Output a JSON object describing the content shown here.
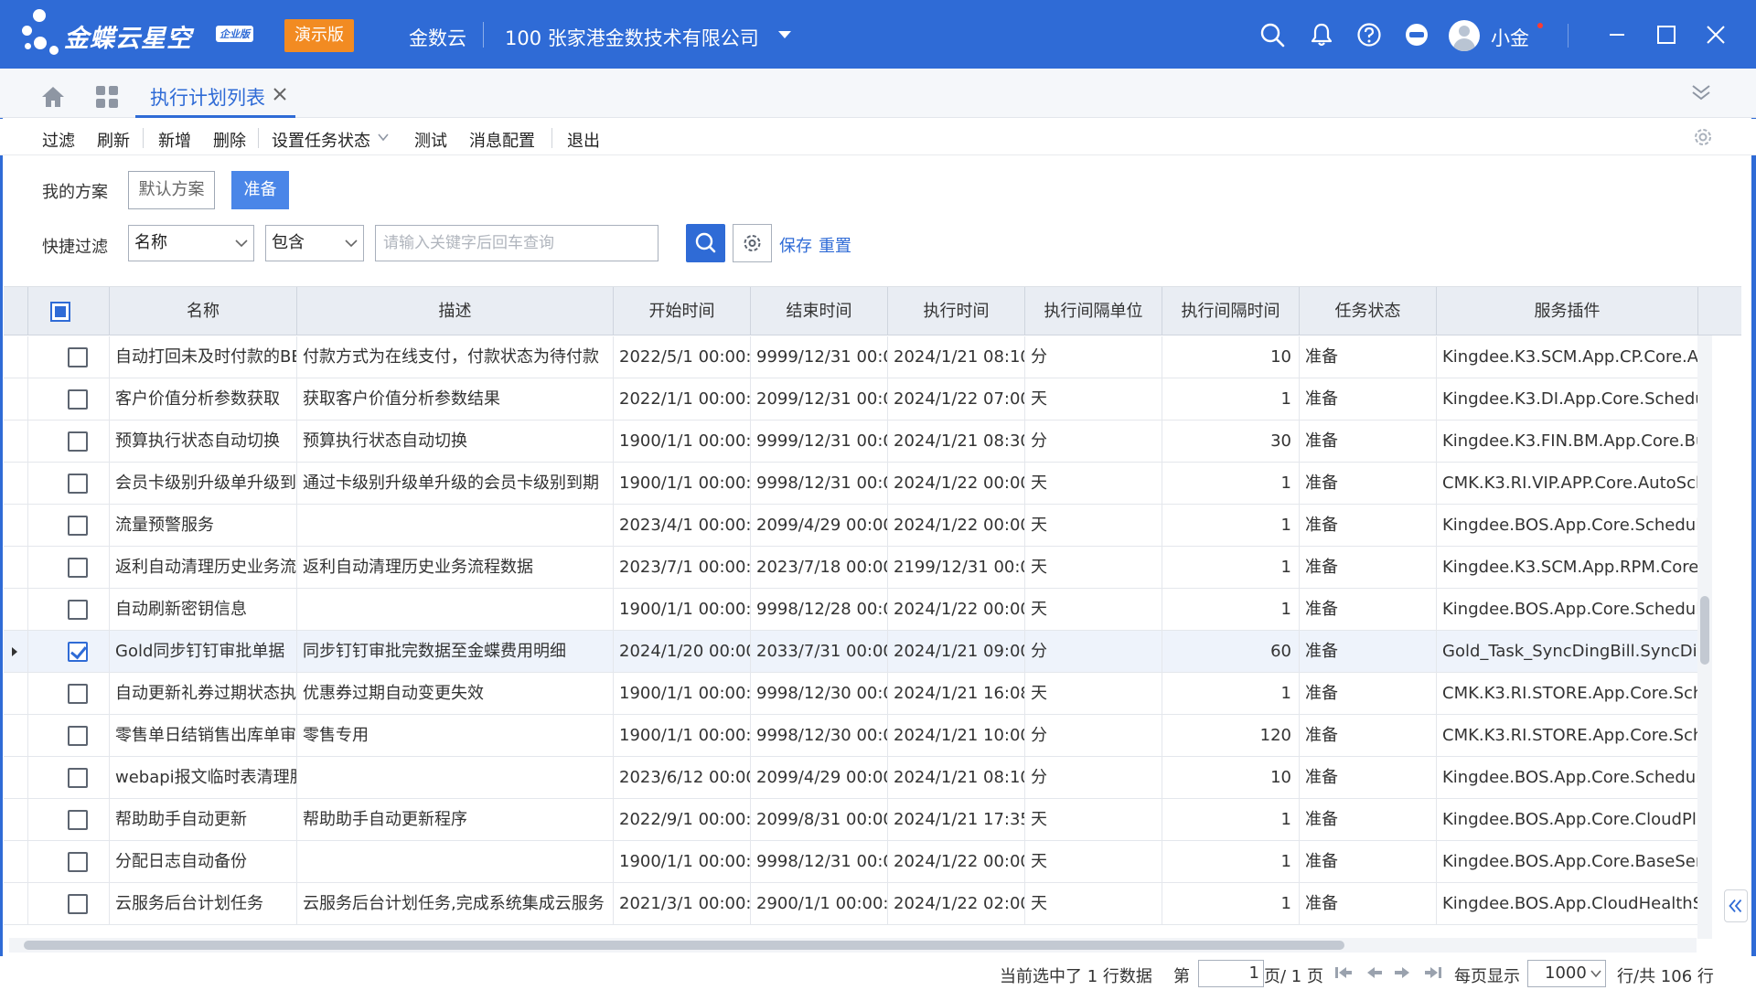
{
  "app": {
    "brand": "金蝶云星空",
    "edition": "企业版",
    "demo_badge": "演示版",
    "tenant": "金数云",
    "org": "100 张家港金数技术有限公司",
    "user_name": "小金",
    "colors": {
      "primary": "#2f6bd6",
      "demo_badge": "#f28b22",
      "selected_row": "#eef3fb"
    }
  },
  "tabs": {
    "active_label": "执行计划列表"
  },
  "toolbar": {
    "filter": "过滤",
    "refresh": "刷新",
    "add": "新增",
    "delete": "删除",
    "set_status": "设置任务状态",
    "test": "测试",
    "message_config": "消息配置",
    "exit": "退出"
  },
  "scheme": {
    "label": "我的方案",
    "default": "默认方案",
    "ready": "准备"
  },
  "quick_filter": {
    "label": "快捷过滤",
    "field": "名称",
    "operator": "包含",
    "placeholder": "请输入关键字后回车查询",
    "save": "保存",
    "reset": "重置"
  },
  "grid": {
    "columns": [
      "名称",
      "描述",
      "开始时间",
      "结束时间",
      "执行时间",
      "执行间隔单位",
      "执行间隔时间",
      "任务状态",
      "服务插件"
    ],
    "rows": [
      {
        "checked": false,
        "name": "自动打回未及时付款的BE",
        "desc": "付款方式为在线支付，付款状态为待付款",
        "start": "2022/5/1 00:00:0",
        "end": "9999/12/31 00:0",
        "exec": "2024/1/21 08:10",
        "unit": "分",
        "interval": "10",
        "status": "准备",
        "plugin": "Kingdee.K3.SCM.App.CP.Core.Au"
      },
      {
        "checked": false,
        "name": "客户价值分析参数获取",
        "desc": "获取客户价值分析参数结果",
        "start": "2022/1/1 00:00:0",
        "end": "2099/12/31 00:0",
        "exec": "2024/1/22 07:00",
        "unit": "天",
        "interval": "1",
        "status": "准备",
        "plugin": "Kingdee.K3.DI.App.Core.Schedul"
      },
      {
        "checked": false,
        "name": "预算执行状态自动切换",
        "desc": "预算执行状态自动切换",
        "start": "1900/1/1 00:00:0",
        "end": "9999/12/31 00:0",
        "exec": "2024/1/21 08:30",
        "unit": "分",
        "interval": "30",
        "status": "准备",
        "plugin": "Kingdee.K3.FIN.BM.App.Core.Bu"
      },
      {
        "checked": false,
        "name": "会员卡级别升级单升级到",
        "desc": "通过卡级别升级单升级的会员卡级别到期",
        "start": "1900/1/1 00:00:0",
        "end": "9998/12/31 00:0",
        "exec": "2024/1/22 00:00",
        "unit": "天",
        "interval": "1",
        "status": "准备",
        "plugin": "CMK.K3.RI.VIP.APP.Core.AutoSch"
      },
      {
        "checked": false,
        "name": "流量预警服务",
        "desc": "",
        "start": "2023/4/1 00:00:0",
        "end": "2099/4/29 00:00",
        "exec": "2024/1/22 00:00",
        "unit": "天",
        "interval": "1",
        "status": "准备",
        "plugin": "Kingdee.BOS.App.Core.Schedule"
      },
      {
        "checked": false,
        "name": "返利自动清理历史业务流",
        "desc": "返利自动清理历史业务流程数据",
        "start": "2023/7/1 00:00:0",
        "end": "2023/7/18 00:00",
        "exec": "2199/12/31 00:0",
        "unit": "天",
        "interval": "1",
        "status": "准备",
        "plugin": "Kingdee.K3.SCM.App.RPM.Core."
      },
      {
        "checked": false,
        "name": "自动刷新密钥信息",
        "desc": "",
        "start": "1900/1/1 00:00:0",
        "end": "9998/12/28 00:0",
        "exec": "2024/1/22 00:00",
        "unit": "天",
        "interval": "1",
        "status": "准备",
        "plugin": "Kingdee.BOS.App.Core.Schedule"
      },
      {
        "checked": true,
        "name": "Gold同步钉钉审批单据",
        "desc": "同步钉钉审批完数据至金蝶费用明细",
        "start": "2024/1/20 00:00",
        "end": "2033/7/31 00:00",
        "exec": "2024/1/21 09:00",
        "unit": "分",
        "interval": "60",
        "status": "准备",
        "plugin": "Gold_Task_SyncDingBill.SyncDin"
      },
      {
        "checked": false,
        "name": "自动更新礼券过期状态执",
        "desc": "优惠券过期自动变更失效",
        "start": "1900/1/1 00:00:0",
        "end": "9998/12/30 00:0",
        "exec": "2024/1/21 16:08",
        "unit": "天",
        "interval": "1",
        "status": "准备",
        "plugin": "CMK.K3.RI.STORE.App.Core.Sche"
      },
      {
        "checked": false,
        "name": "零售单日结销售出库单审",
        "desc": "零售专用",
        "start": "1900/1/1 00:00:0",
        "end": "9998/12/30 00:0",
        "exec": "2024/1/21 10:00",
        "unit": "分",
        "interval": "120",
        "status": "准备",
        "plugin": "CMK.K3.RI.STORE.App.Core.Sche"
      },
      {
        "checked": false,
        "name": "webapi报文临时表清理肌",
        "desc": "",
        "start": "2023/6/12 00:00",
        "end": "2099/4/29 00:00",
        "exec": "2024/1/21 08:10",
        "unit": "分",
        "interval": "10",
        "status": "准备",
        "plugin": "Kingdee.BOS.App.Core.Schedule"
      },
      {
        "checked": false,
        "name": "帮助助手自动更新",
        "desc": "帮助助手自动更新程序",
        "start": "2022/9/1 00:00:0",
        "end": "2099/8/31 00:00",
        "exec": "2024/1/21 17:35",
        "unit": "天",
        "interval": "1",
        "status": "准备",
        "plugin": "Kingdee.BOS.App.Core.CloudPla"
      },
      {
        "checked": false,
        "name": "分配日志自动备份",
        "desc": "",
        "start": "1900/1/1 00:00:0",
        "end": "9998/12/31 00:0",
        "exec": "2024/1/22 00:00",
        "unit": "天",
        "interval": "1",
        "status": "准备",
        "plugin": "Kingdee.BOS.App.Core.BaseServ"
      },
      {
        "checked": false,
        "name": "云服务后台计划任务",
        "desc": "云服务后台计划任务,完成系统集成云服务",
        "start": "2021/3/1 00:00:0",
        "end": "2900/1/1 00:00:0",
        "exec": "2024/1/22 02:00",
        "unit": "天",
        "interval": "1",
        "status": "准备",
        "plugin": "Kingdee.BOS.App.CloudHealthS"
      }
    ]
  },
  "pager": {
    "selected_info": "当前选中了 1 行数据",
    "page_prefix": "第",
    "page_value": "1",
    "page_suffix": "页/ 1 页",
    "page_size_label": "每页显示",
    "page_size": "1000",
    "total": "行/共 106 行"
  }
}
